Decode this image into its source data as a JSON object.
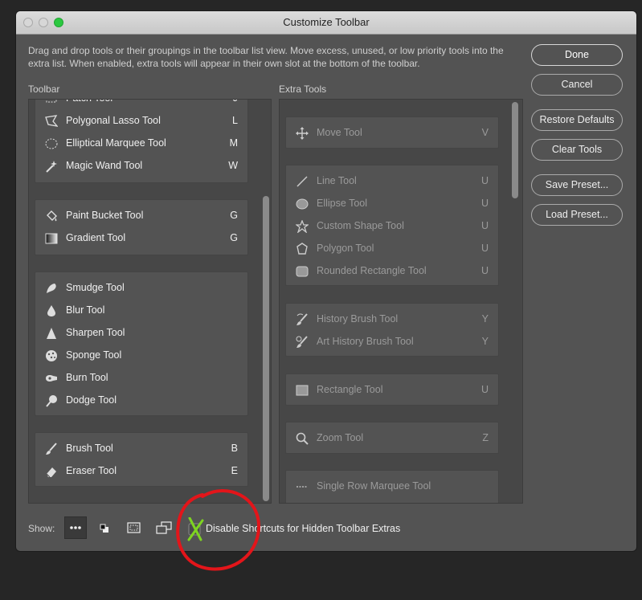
{
  "window": {
    "title": "Customize Toolbar"
  },
  "description": "Drag and drop tools or their groupings in the toolbar list view. Move excess, unused, or low priority tools into the extra list. When enabled, extra tools will appear in their own slot at the bottom of the toolbar.",
  "toolbar_heading": "Toolbar",
  "extra_heading": "Extra Tools",
  "buttons": {
    "done": "Done",
    "cancel": "Cancel",
    "restore": "Restore Defaults",
    "clear": "Clear Tools",
    "save": "Save Preset...",
    "load": "Load Preset..."
  },
  "toolbar_groups": [
    {
      "tools": [
        {
          "label": "Patch Tool",
          "key": "J",
          "icon": "patch-icon"
        },
        {
          "label": "Polygonal Lasso Tool",
          "key": "L",
          "icon": "polygonal-lasso-icon"
        },
        {
          "label": "Elliptical Marquee Tool",
          "key": "M",
          "icon": "elliptical-marquee-icon"
        },
        {
          "label": "Magic Wand Tool",
          "key": "W",
          "icon": "magic-wand-icon"
        }
      ]
    },
    {
      "tools": [
        {
          "label": "Paint Bucket Tool",
          "key": "G",
          "icon": "paint-bucket-icon"
        },
        {
          "label": "Gradient Tool",
          "key": "G",
          "icon": "gradient-icon"
        }
      ]
    },
    {
      "tools": [
        {
          "label": "Smudge Tool",
          "key": "",
          "icon": "smudge-icon"
        },
        {
          "label": "Blur Tool",
          "key": "",
          "icon": "blur-icon"
        },
        {
          "label": "Sharpen Tool",
          "key": "",
          "icon": "sharpen-icon"
        },
        {
          "label": "Sponge Tool",
          "key": "",
          "icon": "sponge-icon"
        },
        {
          "label": "Burn Tool",
          "key": "",
          "icon": "burn-icon"
        },
        {
          "label": "Dodge Tool",
          "key": "",
          "icon": "dodge-icon"
        }
      ]
    },
    {
      "tools": [
        {
          "label": "Brush Tool",
          "key": "B",
          "icon": "brush-icon"
        },
        {
          "label": "Eraser Tool",
          "key": "E",
          "icon": "eraser-icon"
        }
      ]
    }
  ],
  "extra_groups": [
    {
      "tools": [
        {
          "label": "Move Tool",
          "key": "V",
          "icon": "move-icon"
        }
      ]
    },
    {
      "tools": [
        {
          "label": "Line Tool",
          "key": "U",
          "icon": "line-icon"
        },
        {
          "label": "Ellipse Tool",
          "key": "U",
          "icon": "ellipse-icon"
        },
        {
          "label": "Custom Shape Tool",
          "key": "U",
          "icon": "custom-shape-icon"
        },
        {
          "label": "Polygon Tool",
          "key": "U",
          "icon": "polygon-icon"
        },
        {
          "label": "Rounded Rectangle Tool",
          "key": "U",
          "icon": "rounded-rectangle-icon"
        }
      ]
    },
    {
      "tools": [
        {
          "label": "History Brush Tool",
          "key": "Y",
          "icon": "history-brush-icon"
        },
        {
          "label": "Art History Brush Tool",
          "key": "Y",
          "icon": "art-history-brush-icon"
        }
      ]
    },
    {
      "tools": [
        {
          "label": "Rectangle Tool",
          "key": "U",
          "icon": "rectangle-icon"
        }
      ]
    },
    {
      "tools": [
        {
          "label": "Zoom Tool",
          "key": "Z",
          "icon": "zoom-icon"
        }
      ]
    },
    {
      "tools": [
        {
          "label": "Single Row Marquee Tool",
          "key": "",
          "icon": "single-row-marquee-icon"
        }
      ]
    }
  ],
  "footer": {
    "show_label": "Show:",
    "checkbox_label": "Disable Shortcuts for Hidden Toolbar Extras",
    "checkbox_checked": true
  },
  "colors": {
    "annotation_circle": "#e3151a",
    "annotation_check": "#7ed321"
  }
}
